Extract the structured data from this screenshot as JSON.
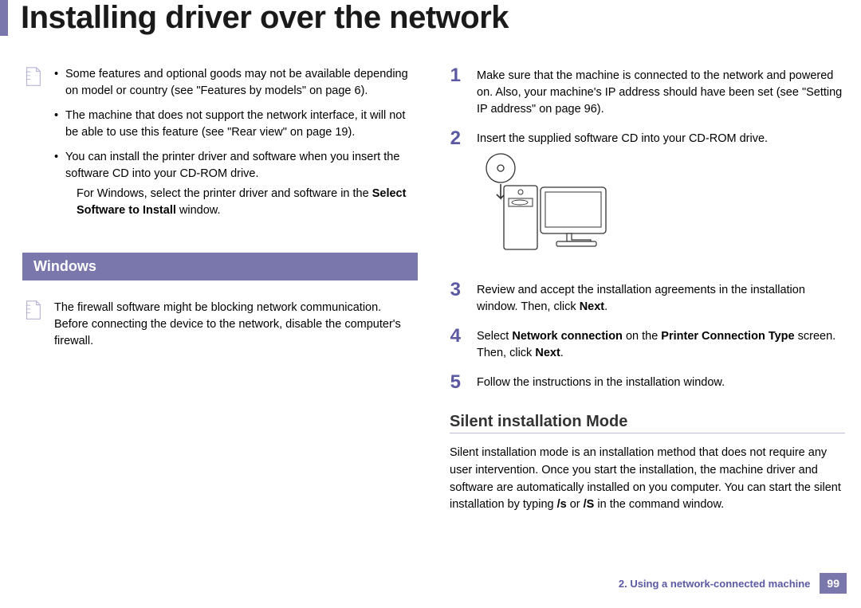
{
  "page_title": "Installing driver over the network",
  "left": {
    "note1": {
      "items": [
        "Some features and optional goods may not be available depending on model or country (see \"Features by models\" on page 6).",
        "The machine that does not support the network interface, it will not be able to use this feature (see \"Rear view\" on page 19).",
        "You can install the printer driver and software when you insert the software CD into your CD-ROM drive."
      ],
      "sub_prefix": "For Windows, select the printer driver and software in the ",
      "sub_bold": "Select Software to Install",
      "sub_suffix": " window."
    },
    "section_header": "Windows",
    "note2": "The firewall software might be blocking network communication. Before connecting the device to the network, disable the computer's firewall."
  },
  "right": {
    "steps": {
      "s1": "Make sure that the machine is connected to the network and powered on. Also, your machine's IP address should have been set (see \"Setting IP address\" on page 96).",
      "s2": "Insert the supplied software CD into your CD-ROM drive.",
      "s3_prefix": "Review and accept the installation agreements in the installation window. Then, click ",
      "s3_bold": "Next",
      "s3_suffix": ".",
      "s4_prefix": "Select ",
      "s4_bold1": "Network connection",
      "s4_mid": " on the ",
      "s4_bold2": "Printer Connection Type",
      "s4_mid2": " screen. Then, click ",
      "s4_bold3": "Next",
      "s4_suffix": ".",
      "s5": "Follow the instructions in the installation window."
    },
    "subheading": "Silent installation Mode",
    "paragraph_prefix": "Silent installation mode is an installation method that does not require any user intervention. Once you start the installation, the machine driver and software are automatically installed on you computer. You can start the silent installation by typing ",
    "paragraph_bold1": "/s",
    "paragraph_mid": " or ",
    "paragraph_bold2": "/S",
    "paragraph_suffix": " in the command window."
  },
  "footer": {
    "chapter": "2.  Using a network-connected machine",
    "page": "99"
  }
}
